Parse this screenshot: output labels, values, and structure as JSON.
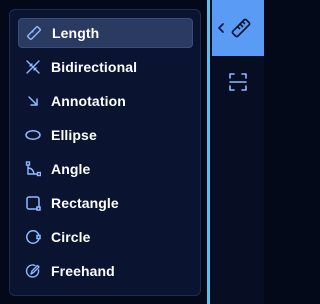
{
  "colors": {
    "background": "#04091a",
    "panel": "#0a1430",
    "active_item": "#2a3a60",
    "icon": "#8fb9ff",
    "accent": "#5a9bf6",
    "divider": "#5ec0e6"
  },
  "menu": {
    "items": [
      {
        "label": "Length",
        "icon": "ruler-icon",
        "active": true
      },
      {
        "label": "Bidirectional",
        "icon": "bidirectional-ruler-icon",
        "active": false
      },
      {
        "label": "Annotation",
        "icon": "arrow-down-right-icon",
        "active": false
      },
      {
        "label": "Ellipse",
        "icon": "ellipse-icon",
        "active": false
      },
      {
        "label": "Angle",
        "icon": "angle-icon",
        "active": false
      },
      {
        "label": "Rectangle",
        "icon": "rectangle-icon",
        "active": false
      },
      {
        "label": "Circle",
        "icon": "circle-icon",
        "active": false
      },
      {
        "label": "Freehand",
        "icon": "freehand-icon",
        "active": false
      }
    ]
  },
  "toolbar": {
    "selected_tool_icon": "ruler-icon",
    "expand_icon": "chevron-left-icon",
    "secondary_tool_icon": "scan-icon"
  }
}
